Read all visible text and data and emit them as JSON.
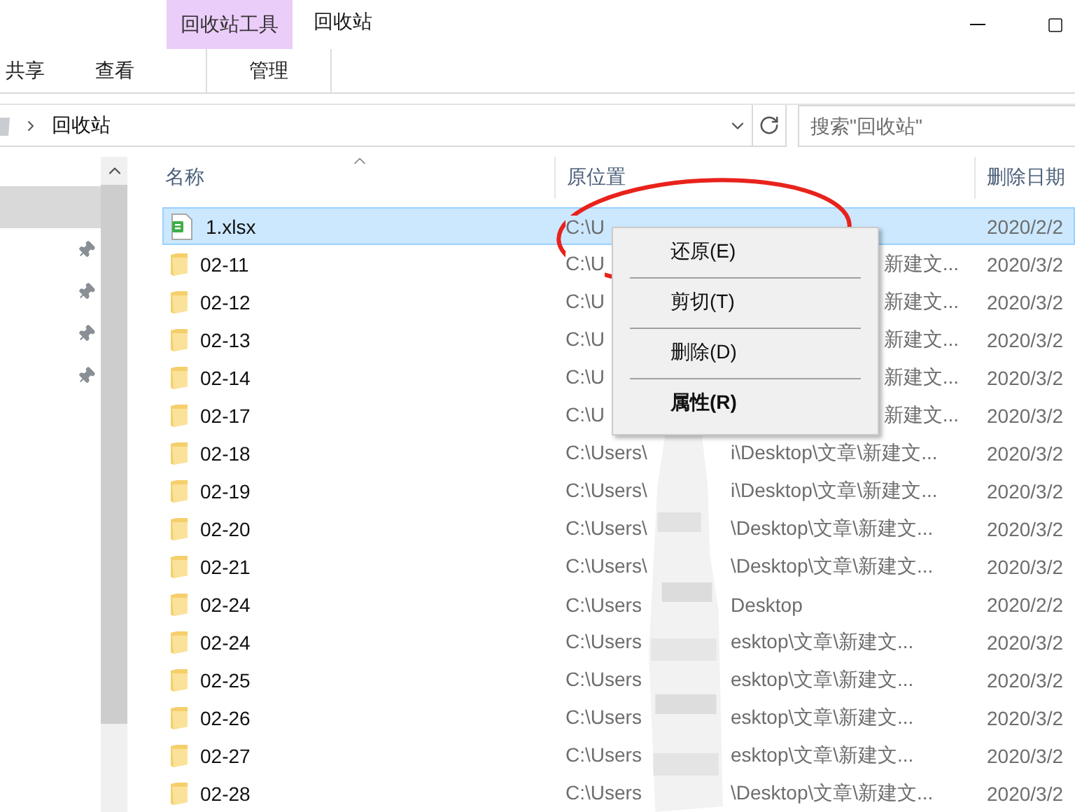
{
  "window": {
    "title": "回收站",
    "context_group": "回收站工具"
  },
  "ribbon_tabs": [
    {
      "label": "共享",
      "kind": "normal"
    },
    {
      "label": "查看",
      "kind": "normal"
    },
    {
      "label": "管理",
      "kind": "contextual"
    }
  ],
  "address": {
    "path": [
      "回收站"
    ]
  },
  "search": {
    "placeholder": "搜索\"回收站\""
  },
  "nav_items": [
    {
      "selected": true,
      "pinned": false
    },
    {
      "selected": false,
      "pinned": true
    },
    {
      "selected": false,
      "pinned": true
    },
    {
      "selected": false,
      "pinned": true
    },
    {
      "selected": false,
      "pinned": true
    }
  ],
  "columns": [
    {
      "label": "名称",
      "sorted": true
    },
    {
      "label": "原位置",
      "sorted": false
    },
    {
      "label": "删除日期",
      "sorted": false
    }
  ],
  "rows": [
    {
      "kind": "xlsx",
      "name": "1.xlsx",
      "selected": true,
      "location_start": "C:\\U",
      "date": "2020/2/2"
    },
    {
      "kind": "folder",
      "name": "02-11",
      "selected": false,
      "location_start": "C:\\U",
      "location_tail": "新建文...",
      "date": "2020/3/2"
    },
    {
      "kind": "folder",
      "name": "02-12",
      "selected": false,
      "location_start": "C:\\U",
      "location_tail": "新建文...",
      "date": "2020/3/2"
    },
    {
      "kind": "folder",
      "name": "02-13",
      "selected": false,
      "location_start": "C:\\U",
      "location_tail": "新建文...",
      "date": "2020/3/2"
    },
    {
      "kind": "folder",
      "name": "02-14",
      "selected": false,
      "location_start": "C:\\U",
      "location_tail": "新建文...",
      "date": "2020/3/2"
    },
    {
      "kind": "folder",
      "name": "02-17",
      "selected": false,
      "location_start": "C:\\U",
      "location_tail": "新建文...",
      "date": "2020/3/2"
    },
    {
      "kind": "folder",
      "name": "02-18",
      "selected": false,
      "location_start": "C:\\Users\\",
      "location_end": "i\\Desktop\\文章\\新建文...",
      "date": "2020/3/2"
    },
    {
      "kind": "folder",
      "name": "02-19",
      "selected": false,
      "location_start": "C:\\Users\\",
      "location_end": "i\\Desktop\\文章\\新建文...",
      "date": "2020/3/2"
    },
    {
      "kind": "folder",
      "name": "02-20",
      "selected": false,
      "location_start": "C:\\Users\\",
      "location_end": "\\Desktop\\文章\\新建文...",
      "date": "2020/3/2"
    },
    {
      "kind": "folder",
      "name": "02-21",
      "selected": false,
      "location_start": "C:\\Users\\",
      "location_end": "\\Desktop\\文章\\新建文...",
      "date": "2020/3/2"
    },
    {
      "kind": "folder",
      "name": "02-24",
      "selected": false,
      "location_start": "C:\\Users",
      "location_end": "Desktop",
      "date": "2020/2/2"
    },
    {
      "kind": "folder",
      "name": "02-24",
      "selected": false,
      "location_start": "C:\\Users",
      "location_end": "esktop\\文章\\新建文...",
      "date": "2020/3/2"
    },
    {
      "kind": "folder",
      "name": "02-25",
      "selected": false,
      "location_start": "C:\\Users",
      "location_end": "esktop\\文章\\新建文...",
      "date": "2020/3/2"
    },
    {
      "kind": "folder",
      "name": "02-26",
      "selected": false,
      "location_start": "C:\\Users",
      "location_end": "esktop\\文章\\新建文...",
      "date": "2020/3/2"
    },
    {
      "kind": "folder",
      "name": "02-27",
      "selected": false,
      "location_start": "C:\\Users",
      "location_end": "esktop\\文章\\新建文...",
      "date": "2020/3/2"
    },
    {
      "kind": "folder",
      "name": "02-28",
      "selected": false,
      "location_start": "C:\\Users",
      "location_end": "\\Desktop\\文章\\新建文...",
      "date": "2020/3/2"
    }
  ],
  "context_menu": {
    "items": [
      {
        "label": "还原(E)",
        "bold": false
      },
      {
        "label": "剪切(T)",
        "bold": false
      },
      {
        "label": "删除(D)",
        "bold": false
      },
      {
        "label": "属性(R)",
        "bold": true
      }
    ]
  }
}
